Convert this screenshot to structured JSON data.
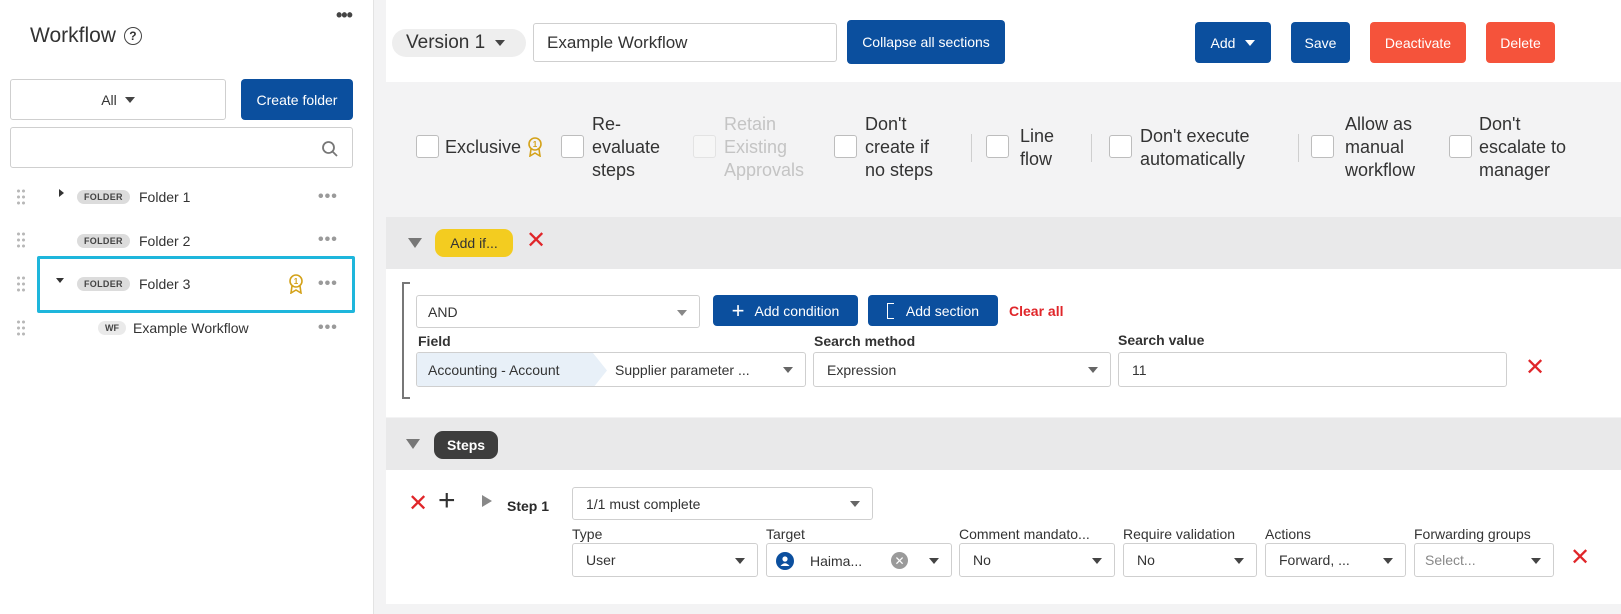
{
  "sidebar": {
    "title": "Workflow",
    "filter_value": "All",
    "create_folder_label": "Create folder",
    "search_placeholder": "",
    "tree": [
      {
        "badge": "FOLDER",
        "label": "Folder 1"
      },
      {
        "badge": "FOLDER",
        "label": "Folder 2"
      },
      {
        "badge": "FOLDER",
        "label": "Folder 3"
      },
      {
        "badge": "WF",
        "label": "Example Workflow"
      }
    ]
  },
  "toolbar": {
    "version_label": "Version 1",
    "workflow_name": "Example Workflow",
    "collapse_label": "Collapse all sections",
    "add_label": "Add",
    "save_label": "Save",
    "deactivate_label": "Deactivate",
    "delete_label": "Delete"
  },
  "options": {
    "exclusive": "Exclusive",
    "reevaluate": [
      "Re-",
      "evaluate",
      "steps"
    ],
    "retain": [
      "Retain",
      "Existing",
      "Approvals"
    ],
    "dont_create": [
      "Don't",
      "create if",
      "no steps"
    ],
    "line_flow": [
      "Line",
      "flow"
    ],
    "dont_execute": [
      "Don't execute",
      "automatically"
    ],
    "allow_manual": [
      "Allow as",
      "manual",
      "workflow"
    ],
    "dont_escalate": [
      "Don't",
      "escalate to",
      "manager"
    ]
  },
  "add_if": {
    "pill_label": "Add if...",
    "operator": "AND",
    "add_condition_label": "Add condition",
    "add_section_label": "Add section",
    "clear_all_label": "Clear all",
    "field_label": "Field",
    "field_path_1": "Accounting - Account",
    "field_path_2": "Supplier parameter ...",
    "search_method_label": "Search method",
    "search_method_value": "Expression",
    "search_value_label": "Search value",
    "search_value": "11"
  },
  "steps": {
    "pill_label": "Steps",
    "step_label": "Step 1",
    "completion": "1/1 must complete",
    "type_label": "Type",
    "type_value": "User",
    "target_label": "Target",
    "target_value": "Haima...",
    "comment_label": "Comment mandato...",
    "comment_value": "No",
    "validation_label": "Require validation",
    "validation_value": "No",
    "actions_label": "Actions",
    "actions_value": "Forward, ...",
    "forwarding_label": "Forwarding groups",
    "forwarding_placeholder": "Select..."
  },
  "colors": {
    "primary": "#0b4f9e",
    "danger": "#f5533b",
    "accent_yellow": "#f3cc20",
    "selection": "#1eb6dc"
  }
}
